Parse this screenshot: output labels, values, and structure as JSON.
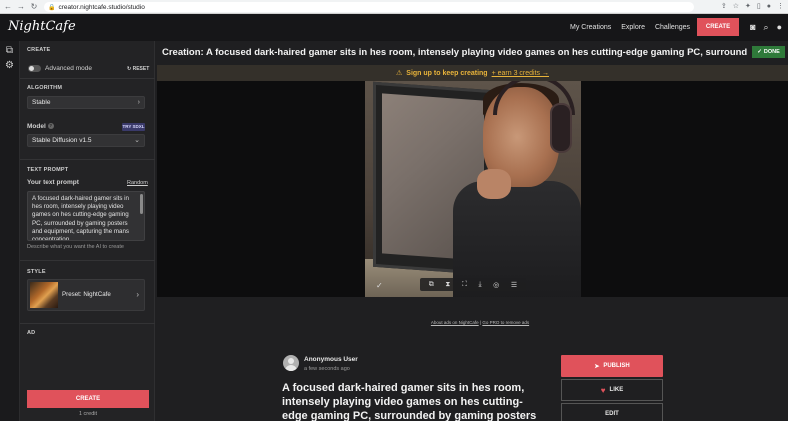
{
  "browser": {
    "url": "creator.nightcafe.studio/studio",
    "back_icon": "back-arrow-icon",
    "forward_icon": "forward-arrow-icon",
    "reload_icon": "reload-icon"
  },
  "header": {
    "logo": "NightCafe",
    "nav": [
      "My Creations",
      "Explore",
      "Challenges"
    ],
    "create_label": "CREATE",
    "accent_color": "#e0525b"
  },
  "sidebar": {
    "section_title": "CREATE",
    "advanced_mode_label": "Advanced mode",
    "reset_label": "RESET",
    "algorithm_label": "ALGORITHM",
    "algorithm_value": "Stable",
    "model_label": "Model",
    "try_badge": "TRY SDXL",
    "model_value": "Stable Diffusion v1.5",
    "text_prompt_label": "TEXT PROMPT",
    "your_prompt_label": "Your text prompt",
    "random_label": "Random",
    "prompt_text": "A focused dark-haired gamer sits in hes room, intensely playing video games on hes cutting-edge gaming PC, surrounded by gaming posters and equipment, capturing the mans concentration",
    "prompt_hint": "Describe what you want the AI to create",
    "style_label": "STYLE",
    "style_value": "Preset: NightCafe",
    "ad_label": "AD",
    "create_label": "CREATE",
    "credit_text": "1 credit"
  },
  "main": {
    "title": "Creation: A focused dark-haired gamer sits in hes room, intensely playing video games on hes cutting-edge gaming PC, surrounded...",
    "done_label": "DONE",
    "signup_text": "Sign up to keep creating",
    "earn_text": "+ earn 3 credits →",
    "ads_text": "About ads on NightCafe",
    "ads_sep": " | ",
    "ads_link": "Go PRO to remove ads",
    "author": "Anonymous User",
    "time": "a few seconds ago",
    "prompt_title": "A focused dark-haired gamer sits in hes room, intensely playing video games on hes cutting-edge gaming PC, surrounded by gaming posters",
    "publish_label": "PUBLISH",
    "like_label": "LIKE",
    "edit_label": "EDIT"
  }
}
